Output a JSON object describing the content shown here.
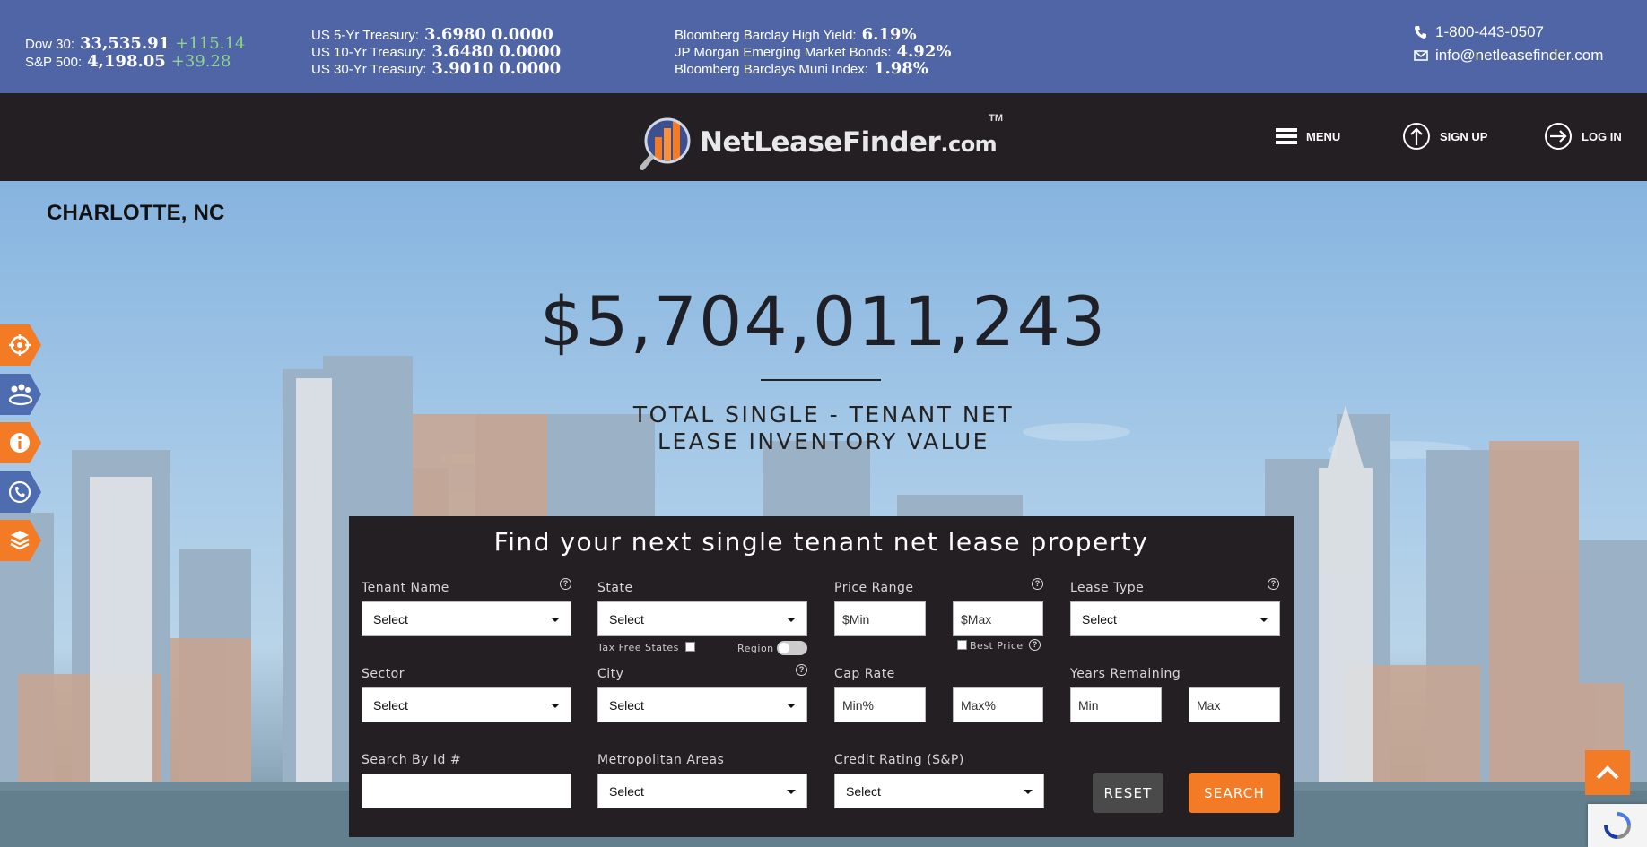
{
  "ticker": {
    "dow_label": "Dow 30:",
    "dow_value": "33,535.91",
    "dow_change": "+115.14",
    "sp_label": "S&P 500:",
    "sp_value": "4,198.05",
    "sp_change": "+39.28",
    "t5_label": "US 5-Yr Treasury:",
    "t5_value": "3.6980",
    "t5_change": "0.0000",
    "t10_label": "US 10-Yr Treasury:",
    "t10_value": "3.6480",
    "t10_change": "0.0000",
    "t30_label": "US 30-Yr Treasury:",
    "t30_value": "3.9010",
    "t30_change": "0.0000",
    "hy_label": "Bloomberg Barclay High Yield:",
    "hy_value": "6.19%",
    "em_label": "JP Morgan Emerging Market Bonds:",
    "em_value": "4.92%",
    "muni_label": "Bloomberg Barclays Muni Index:",
    "muni_value": "1.98%",
    "phone": "1-800-443-0507",
    "email": "info@netleasefinder.com"
  },
  "nav": {
    "logo_main": "NetLeaseFinder",
    "logo_suffix": ".com",
    "logo_tm": "TM",
    "menu_label": "MENU",
    "signup_label": "SIGN UP",
    "login_label": "LOG IN"
  },
  "hero": {
    "city": "CHARLOTTE, NC",
    "total_value": "$5,704,011,243",
    "total_label_line1": "TOTAL SINGLE - TENANT NET",
    "total_label_line2": "LEASE INVENTORY VALUE"
  },
  "side_tabs": [
    "target-icon",
    "group-icon",
    "info-icon",
    "phone-icon",
    "layers-icon"
  ],
  "search": {
    "title": "Find your next single tenant net lease property",
    "tenant_name_label": "Tenant Name",
    "state_label": "State",
    "price_range_label": "Price Range",
    "lease_type_label": "Lease Type",
    "sector_label": "Sector",
    "city_label": "City",
    "cap_rate_label": "Cap Rate",
    "years_remaining_label": "Years Remaining",
    "search_by_id_label": "Search By Id #",
    "metro_label": "Metropolitan Areas",
    "credit_label": "Credit Rating (S&P)",
    "select_text": "Select",
    "price_min_placeholder": "$Min",
    "price_max_placeholder": "$Max",
    "cap_min_placeholder": "Min%",
    "cap_max_placeholder": "Max%",
    "years_min_placeholder": "Min",
    "years_max_placeholder": "Max",
    "tax_free_label": "Tax Free States",
    "region_label": "Region",
    "best_price_label": "Best Price",
    "help_glyph": "?",
    "reset_label": "RESET",
    "search_label": "SEARCH"
  },
  "colors": {
    "accent": "#f47b25",
    "ticker_bg": "#5065a6",
    "nav_bg": "#241f23",
    "positive": "#8fd48a"
  }
}
